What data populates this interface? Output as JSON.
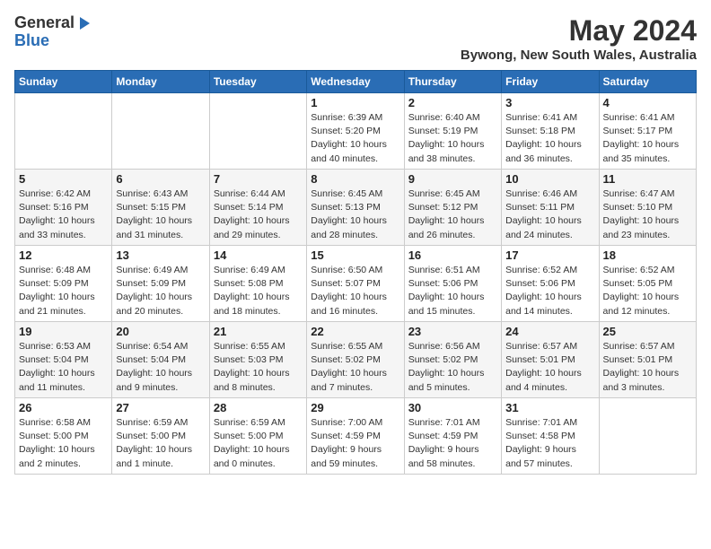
{
  "logo": {
    "general": "General",
    "blue": "Blue"
  },
  "title": "May 2024",
  "subtitle": "Bywong, New South Wales, Australia",
  "days_of_week": [
    "Sunday",
    "Monday",
    "Tuesday",
    "Wednesday",
    "Thursday",
    "Friday",
    "Saturday"
  ],
  "weeks": [
    [
      {
        "day": "",
        "info": ""
      },
      {
        "day": "",
        "info": ""
      },
      {
        "day": "",
        "info": ""
      },
      {
        "day": "1",
        "info": "Sunrise: 6:39 AM\nSunset: 5:20 PM\nDaylight: 10 hours\nand 40 minutes."
      },
      {
        "day": "2",
        "info": "Sunrise: 6:40 AM\nSunset: 5:19 PM\nDaylight: 10 hours\nand 38 minutes."
      },
      {
        "day": "3",
        "info": "Sunrise: 6:41 AM\nSunset: 5:18 PM\nDaylight: 10 hours\nand 36 minutes."
      },
      {
        "day": "4",
        "info": "Sunrise: 6:41 AM\nSunset: 5:17 PM\nDaylight: 10 hours\nand 35 minutes."
      }
    ],
    [
      {
        "day": "5",
        "info": "Sunrise: 6:42 AM\nSunset: 5:16 PM\nDaylight: 10 hours\nand 33 minutes."
      },
      {
        "day": "6",
        "info": "Sunrise: 6:43 AM\nSunset: 5:15 PM\nDaylight: 10 hours\nand 31 minutes."
      },
      {
        "day": "7",
        "info": "Sunrise: 6:44 AM\nSunset: 5:14 PM\nDaylight: 10 hours\nand 29 minutes."
      },
      {
        "day": "8",
        "info": "Sunrise: 6:45 AM\nSunset: 5:13 PM\nDaylight: 10 hours\nand 28 minutes."
      },
      {
        "day": "9",
        "info": "Sunrise: 6:45 AM\nSunset: 5:12 PM\nDaylight: 10 hours\nand 26 minutes."
      },
      {
        "day": "10",
        "info": "Sunrise: 6:46 AM\nSunset: 5:11 PM\nDaylight: 10 hours\nand 24 minutes."
      },
      {
        "day": "11",
        "info": "Sunrise: 6:47 AM\nSunset: 5:10 PM\nDaylight: 10 hours\nand 23 minutes."
      }
    ],
    [
      {
        "day": "12",
        "info": "Sunrise: 6:48 AM\nSunset: 5:09 PM\nDaylight: 10 hours\nand 21 minutes."
      },
      {
        "day": "13",
        "info": "Sunrise: 6:49 AM\nSunset: 5:09 PM\nDaylight: 10 hours\nand 20 minutes."
      },
      {
        "day": "14",
        "info": "Sunrise: 6:49 AM\nSunset: 5:08 PM\nDaylight: 10 hours\nand 18 minutes."
      },
      {
        "day": "15",
        "info": "Sunrise: 6:50 AM\nSunset: 5:07 PM\nDaylight: 10 hours\nand 16 minutes."
      },
      {
        "day": "16",
        "info": "Sunrise: 6:51 AM\nSunset: 5:06 PM\nDaylight: 10 hours\nand 15 minutes."
      },
      {
        "day": "17",
        "info": "Sunrise: 6:52 AM\nSunset: 5:06 PM\nDaylight: 10 hours\nand 14 minutes."
      },
      {
        "day": "18",
        "info": "Sunrise: 6:52 AM\nSunset: 5:05 PM\nDaylight: 10 hours\nand 12 minutes."
      }
    ],
    [
      {
        "day": "19",
        "info": "Sunrise: 6:53 AM\nSunset: 5:04 PM\nDaylight: 10 hours\nand 11 minutes."
      },
      {
        "day": "20",
        "info": "Sunrise: 6:54 AM\nSunset: 5:04 PM\nDaylight: 10 hours\nand 9 minutes."
      },
      {
        "day": "21",
        "info": "Sunrise: 6:55 AM\nSunset: 5:03 PM\nDaylight: 10 hours\nand 8 minutes."
      },
      {
        "day": "22",
        "info": "Sunrise: 6:55 AM\nSunset: 5:02 PM\nDaylight: 10 hours\nand 7 minutes."
      },
      {
        "day": "23",
        "info": "Sunrise: 6:56 AM\nSunset: 5:02 PM\nDaylight: 10 hours\nand 5 minutes."
      },
      {
        "day": "24",
        "info": "Sunrise: 6:57 AM\nSunset: 5:01 PM\nDaylight: 10 hours\nand 4 minutes."
      },
      {
        "day": "25",
        "info": "Sunrise: 6:57 AM\nSunset: 5:01 PM\nDaylight: 10 hours\nand 3 minutes."
      }
    ],
    [
      {
        "day": "26",
        "info": "Sunrise: 6:58 AM\nSunset: 5:00 PM\nDaylight: 10 hours\nand 2 minutes."
      },
      {
        "day": "27",
        "info": "Sunrise: 6:59 AM\nSunset: 5:00 PM\nDaylight: 10 hours\nand 1 minute."
      },
      {
        "day": "28",
        "info": "Sunrise: 6:59 AM\nSunset: 5:00 PM\nDaylight: 10 hours\nand 0 minutes."
      },
      {
        "day": "29",
        "info": "Sunrise: 7:00 AM\nSunset: 4:59 PM\nDaylight: 9 hours\nand 59 minutes."
      },
      {
        "day": "30",
        "info": "Sunrise: 7:01 AM\nSunset: 4:59 PM\nDaylight: 9 hours\nand 58 minutes."
      },
      {
        "day": "31",
        "info": "Sunrise: 7:01 AM\nSunset: 4:58 PM\nDaylight: 9 hours\nand 57 minutes."
      },
      {
        "day": "",
        "info": ""
      }
    ]
  ]
}
